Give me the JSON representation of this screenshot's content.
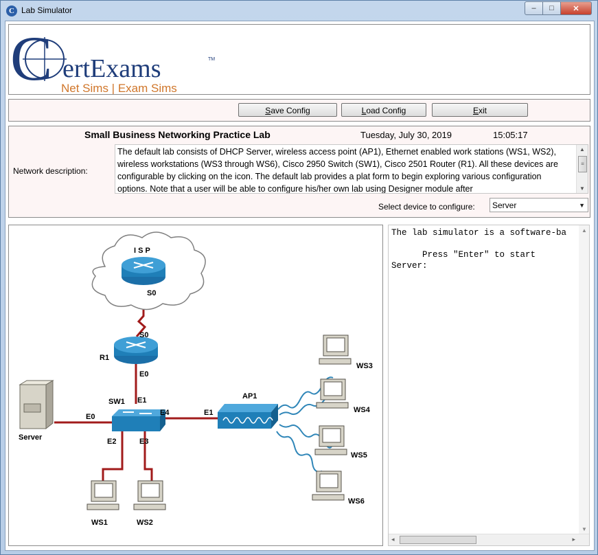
{
  "window": {
    "title": "Lab Simulator",
    "min_glyph": "–",
    "max_glyph": "□",
    "close_glyph": "✕"
  },
  "logo": {
    "brand": "ertExams",
    "brand_initial": "C",
    "tm": "TM",
    "tagline": "Net Sims | Exam Sims"
  },
  "toolbar": {
    "save_label": "Save Config",
    "save_key": "S",
    "load_label": "Load Config",
    "load_key": "L",
    "exit_label": "Exit",
    "exit_key": "E"
  },
  "info": {
    "lab_title": "Small Business Networking Practice Lab",
    "date": "Tuesday, July 30, 2019",
    "time": "15:05:17",
    "description_label": "Network description:",
    "description": "The default lab consists of DHCP Server, wireless access point (AP1), Ethernet enabled work stations (WS1, WS2), wireless workstations (WS3 through WS6), Cisco 2950 Switch (SW1), Cisco 2501 Router (R1). All these devices are configurable by clicking on the icon. The default lab provides a plat form to begin exploring various configuration options. Note that a user will be able to configure his/her own lab using Designer module after",
    "select_label": "Select device to configure:",
    "selected_device": "Server"
  },
  "diagram": {
    "isp": "I S P",
    "isp_s0": "S0",
    "r1": "R1",
    "r1_s0": "S0",
    "r1_e0": "E0",
    "sw1": "SW1",
    "sw1_e1": "E1",
    "sw1_e4": "E4",
    "sw1_e2": "E2",
    "sw1_e3": "E3",
    "server": "Server",
    "server_e0": "E0",
    "ap1": "AP1",
    "ap1_e1": "E1",
    "ws1": "WS1",
    "ws2": "WS2",
    "ws3": "WS3",
    "ws4": "WS4",
    "ws5": "WS5",
    "ws6": "WS6",
    "colors": {
      "link": "#a11b1b",
      "device": "#1f7fb8",
      "wireless": "#2f86b8"
    }
  },
  "console": {
    "lines": [
      "The lab simulator is a software-ba",
      "",
      "      Press \"Enter\" to start",
      "Server:"
    ]
  }
}
